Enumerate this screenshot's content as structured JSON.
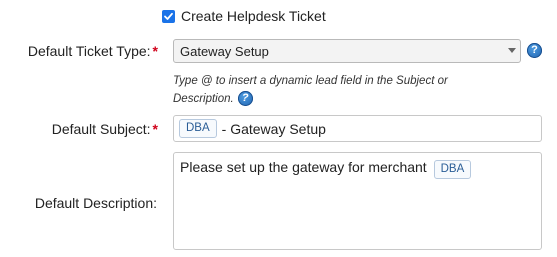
{
  "create_ticket": {
    "label": "Create Helpdesk Ticket",
    "checked": true
  },
  "ticket_type": {
    "label": "Default Ticket Type:",
    "value": "Gateway Setup"
  },
  "hint": {
    "text": "Type @ to insert a dynamic lead field in the Subject or Description."
  },
  "subject": {
    "label": "Default Subject:",
    "token": "DBA",
    "text": "- Gateway Setup"
  },
  "description": {
    "label": "Default Description:",
    "text": "Please set up the gateway for merchant",
    "token": "DBA"
  },
  "required_mark": "*",
  "help_glyph": "?"
}
